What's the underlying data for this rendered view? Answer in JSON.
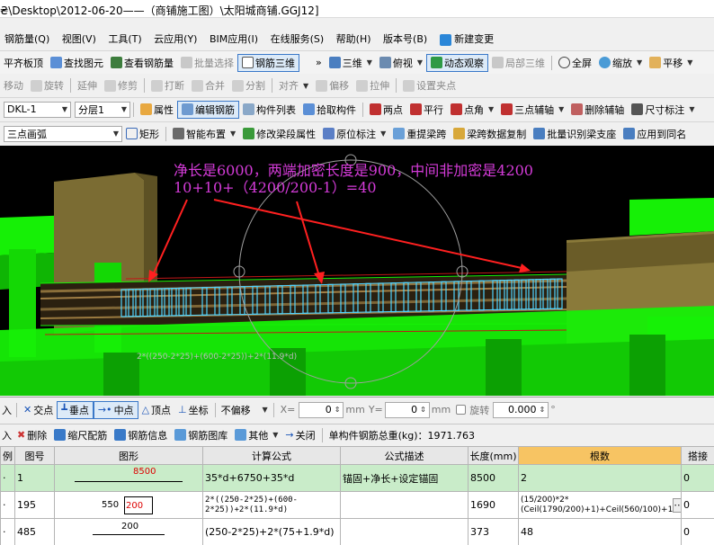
{
  "title": "₴\\Desktop\\2012-06-20——（商铺施工图）\\太阳城商铺.GGJ12]",
  "menu": [
    "钢筋量(Q)",
    "视图(V)",
    "工具(T)",
    "云应用(Y)",
    "BIM应用(I)",
    "在线服务(S)",
    "帮助(H)",
    "版本号(B)",
    "新建变更"
  ],
  "tb1": {
    "items": [
      "平齐板顶",
      "查找图元",
      "查看钢筋量",
      "批量选择",
      "钢筋三维"
    ],
    "right": [
      "三维",
      "俯视",
      "动态观察",
      "局部三维",
      "全屏",
      "缩放",
      "平移"
    ]
  },
  "tb2": [
    "移动",
    "旋转",
    "延伸",
    "修剪",
    "打断",
    "合并",
    "分割",
    "对齐",
    "偏移",
    "拉伸",
    "设置夹点"
  ],
  "tb3": {
    "element": "DKL-1",
    "layer": "分层1",
    "items": [
      "属性",
      "编辑钢筋",
      "构件列表",
      "拾取构件",
      "两点",
      "平行",
      "点角",
      "三点辅轴",
      "删除辅轴",
      "尺寸标注"
    ]
  },
  "tb4": {
    "draw": "三点画弧",
    "items": [
      "矩形",
      "智能布置",
      "修改梁段属性",
      "原位标注",
      "重提梁跨",
      "梁跨数据复制",
      "批量识别梁支座",
      "应用到同名"
    ]
  },
  "annotation": {
    "line1": "净长是6000，两端加密长度是900，中间非加密是4200",
    "line2": "10+10+（4200/200-1）=40",
    "formula": "2*((250-2*25)+(600-2*25))+2*(11.9*d)"
  },
  "snap": {
    "items": [
      "交点",
      "垂点",
      "中点",
      "顶点",
      "坐标"
    ],
    "mode": "不偏移",
    "x_label": "X=",
    "x_value": "0",
    "y_label": "Y=",
    "y_value": "0",
    "unit": "mm",
    "rotate_label": "旋转",
    "rotate_value": "0.000",
    "deg": "°"
  },
  "gridtb": {
    "items": [
      "删除",
      "缩尺配筋",
      "钢筋信息",
      "钢筋图库",
      "其他",
      "关闭"
    ],
    "total": "单构件钢筋总重(kg)：1971.763"
  },
  "grid": {
    "headers": [
      "例",
      "图号",
      "图形",
      "计算公式",
      "公式描述",
      "长度(mm)",
      "根数",
      "搭接"
    ],
    "rows": [
      {
        "c0": "·",
        "c1": "1",
        "shape_val": "8500",
        "formula": "35*d+6750+35*d",
        "desc": "锚固+净长+设定锚固",
        "length": "8500",
        "count": "2",
        "lap": "0"
      },
      {
        "c0": "·",
        "c1": "195",
        "shape_a": "550",
        "shape_b": "200",
        "formula": "2*((250-2*25)+(600-2*25))+2*(11.9*d)",
        "desc": "",
        "length": "1690",
        "count": "(15/200)*2*(Ceil(1790/200)+1)+Ceil(560/100)+1",
        "lap": "0"
      },
      {
        "c0": "·",
        "c1": "485",
        "shape_val": "200",
        "formula": "(250-2*25)+2*(75+1.9*d)",
        "desc": "",
        "length": "373",
        "count": "48",
        "lap": "0"
      }
    ]
  },
  "colors": {
    "beam_green": "#16f006",
    "wall": "#8a7a3a",
    "stirrup": "#4fd3ff",
    "annotation": "#d43bd8",
    "arrow": "#ff2020",
    "highlight_header": "#f7c463",
    "selected_row": "#c9ecc9"
  }
}
